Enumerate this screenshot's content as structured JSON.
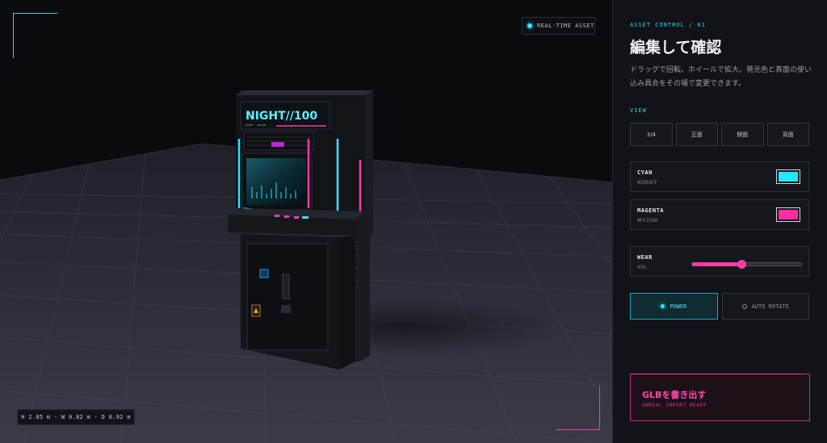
{
  "viewport": {
    "badge_label": "REAL-TIME ASSET",
    "dimensions": "H 2.05 m · W 0.82 m · D 0.92 m",
    "cabinet": {
      "marquee_title": "NIGHT//100",
      "marquee_sub": "BLADE · ONLINE"
    }
  },
  "panel": {
    "eyebrow": "ASSET CONTROL / 01",
    "title": "編集して確認",
    "description": "ドラッグで回転、ホイールで拡大。発光色と表面の使い込み具合をその場で変更できます。",
    "view_label": "VIEW",
    "views": [
      {
        "label": "3/4"
      },
      {
        "label": "正面"
      },
      {
        "label": "側面"
      },
      {
        "label": "背面"
      }
    ],
    "colors": [
      {
        "name": "CYAN",
        "hex": "#20EAFF",
        "color": "#20EAFF"
      },
      {
        "name": "MAGENTA",
        "hex": "#FF2CA6",
        "color": "#FF2CA6"
      }
    ],
    "wear": {
      "name": "WEAR",
      "value_label": "45%",
      "value": 45
    },
    "toggles": {
      "power": {
        "label": "POWER",
        "on": true
      },
      "auto_rotate": {
        "label": "AUTO ROTATE",
        "on": false
      }
    },
    "export": {
      "title": "GLBを書き出す",
      "subtitle": "UNREAL IMPORT READY"
    }
  },
  "accent": {
    "cyan": "#2ee4ff",
    "magenta": "#ff3aa6"
  }
}
